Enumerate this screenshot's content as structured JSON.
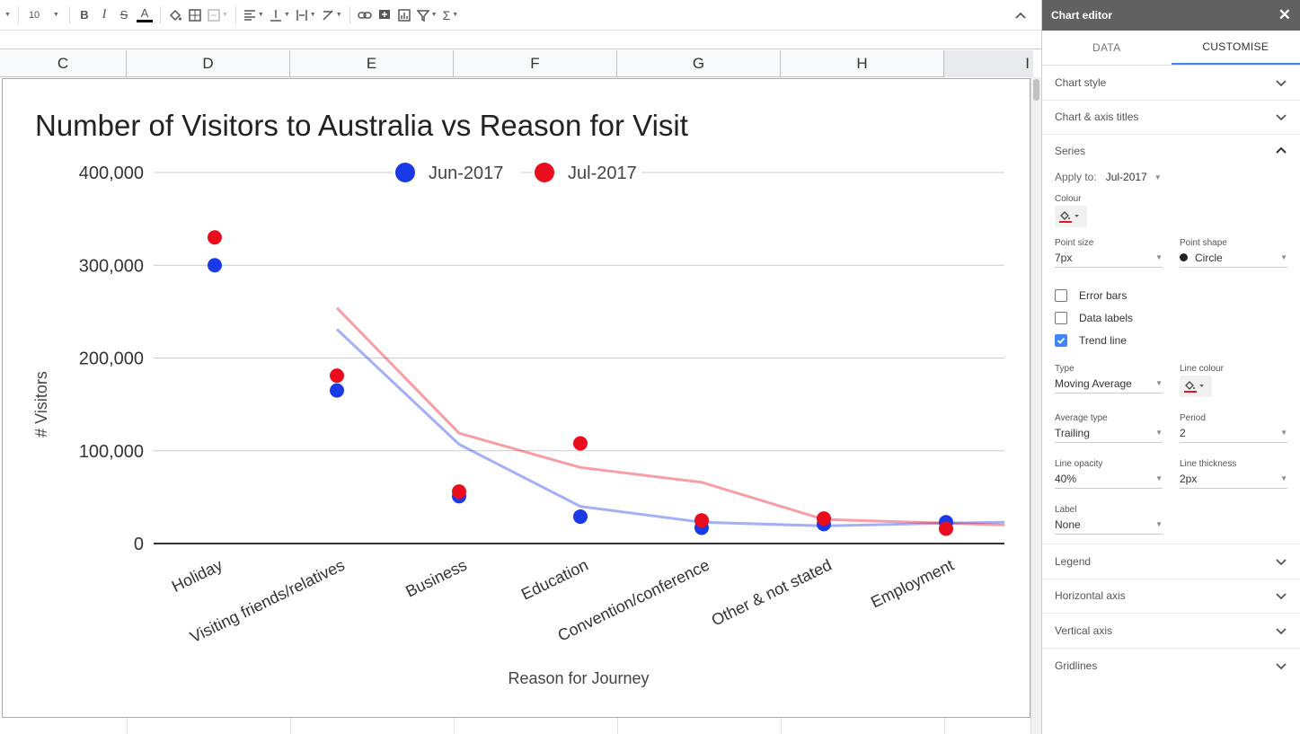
{
  "toolbar": {
    "font_size": "10",
    "bold": "B",
    "italic": "I",
    "strike": "S",
    "text_color_letter": "A",
    "sigma": "Σ"
  },
  "columns": [
    "C",
    "D",
    "E",
    "F",
    "G",
    "H",
    "I"
  ],
  "colors": {
    "jun": "#1a3ae8",
    "jul": "#ea0d1d",
    "accent": "#4285f4",
    "line_colour_swatch": "#d91a2a"
  },
  "chart_data": {
    "type": "scatter",
    "title": "Number of Visitors to Australia vs Reason for Visit",
    "xlabel": "Reason for Journey",
    "ylabel": "# Visitors",
    "categories": [
      "Holiday",
      "Visiting friends/relatives",
      "Business",
      "Education",
      "Convention/conference",
      "Other & not stated",
      "Employment"
    ],
    "ylim": [
      0,
      400000
    ],
    "yticks": [
      0,
      100000,
      200000,
      300000,
      400000
    ],
    "ytick_labels": [
      "0",
      "100,000",
      "200,000",
      "300,000",
      "400,000"
    ],
    "grid": true,
    "legend_position": "top",
    "series": [
      {
        "name": "Jun-2017",
        "values": [
          300000,
          165000,
          51000,
          29000,
          17000,
          21000,
          23000
        ]
      },
      {
        "name": "Jul-2017",
        "values": [
          330000,
          181000,
          56000,
          108000,
          25000,
          27000,
          16000
        ]
      }
    ],
    "trendlines": [
      {
        "series": "Jun-2017",
        "type": "Moving Average",
        "period": 2,
        "opacity": 0.4,
        "values": [
          null,
          231000,
          107000,
          40000,
          23000,
          19000,
          22000,
          23000
        ]
      },
      {
        "series": "Jul-2017",
        "type": "Moving Average",
        "period": 2,
        "opacity": 0.4,
        "values": [
          null,
          254000,
          119000,
          82000,
          66000,
          26000,
          22000,
          20000
        ]
      }
    ]
  },
  "panel": {
    "title": "Chart editor",
    "close": "✕",
    "tabs": [
      "DATA",
      "CUSTOMISE"
    ],
    "sections_top": [
      "Chart style",
      "Chart & axis titles",
      "Series"
    ],
    "apply_to_label": "Apply to:",
    "apply_to_value": "Jul-2017",
    "colour_label": "Colour",
    "point_size_label": "Point size",
    "point_size_value": "7px",
    "point_shape_label": "Point shape",
    "point_shape_value": "Circle",
    "error_bars": "Error bars",
    "data_labels": "Data labels",
    "trend_line": "Trend line",
    "type_label": "Type",
    "type_value": "Moving Average",
    "line_colour_label": "Line colour",
    "avg_type_label": "Average type",
    "avg_type_value": "Trailing",
    "period_label": "Period",
    "period_value": "2",
    "line_opacity_label": "Line opacity",
    "line_opacity_value": "40%",
    "line_thickness_label": "Line thickness",
    "line_thickness_value": "2px",
    "label_label": "Label",
    "label_value": "None",
    "sections_bottom": [
      "Legend",
      "Horizontal axis",
      "Vertical axis",
      "Gridlines"
    ]
  }
}
